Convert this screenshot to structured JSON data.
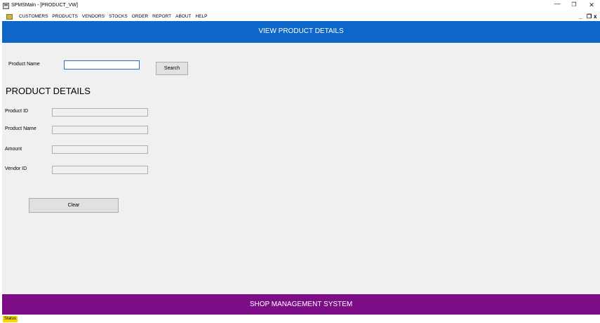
{
  "window": {
    "title": "SPMSMain - [PRODUCT_VW]",
    "min_glyph": "—",
    "max_glyph": "❐",
    "close_glyph": "✕"
  },
  "menu": {
    "items": [
      "CUSTOMERS",
      "PRODUCTS",
      "VENDORS",
      "STOCKS",
      "ORDER",
      "REPORT",
      "ABOUT",
      "HELP"
    ],
    "mdi_min": "_",
    "mdi_restore": "❐",
    "mdi_close": "x"
  },
  "header": {
    "title": "VIEW PRODUCT DETAILS",
    "color": "#0e67c8"
  },
  "search": {
    "label": "Product Name",
    "value": "",
    "button_label": "Search"
  },
  "details": {
    "title": "PRODUCT DETAILS",
    "fields": [
      {
        "label": "Product ID",
        "value": ""
      },
      {
        "label": "Product Name",
        "value": ""
      },
      {
        "label": "Amount",
        "value": ""
      },
      {
        "label": "Vendor ID",
        "value": ""
      }
    ],
    "clear_label": "Clear"
  },
  "footer": {
    "title": "SHOP MANAGEMENT SYSTEM",
    "color": "#7d0d87"
  },
  "status": {
    "text": "Status",
    "color": "#f5d800"
  }
}
